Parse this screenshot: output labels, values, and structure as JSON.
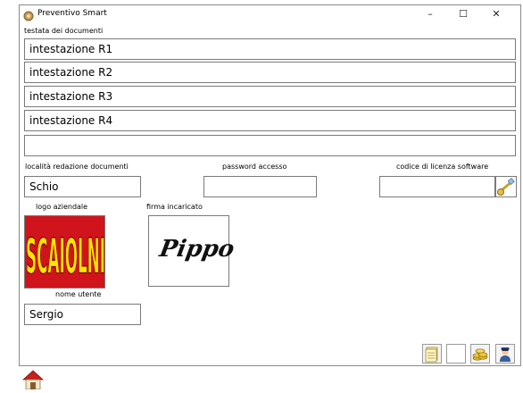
{
  "window": {
    "title": "Preventivo Smart",
    "controls": {
      "minimize": "–",
      "maximize": "☐",
      "close": "✕"
    }
  },
  "header_section": {
    "label": "testata dei documenti",
    "lines": [
      "intestazione R1",
      "intestazione R2",
      "intestazione R3",
      "intestazione R4",
      ""
    ]
  },
  "fields": {
    "location_label": "località redazione documenti",
    "location_value": "Schio",
    "password_label": "password accesso",
    "password_value": "",
    "license_label": "codice di licenza software",
    "license_value": ""
  },
  "images": {
    "logo_label": "logo aziendale",
    "logo_text": "SCAIOLNI",
    "signature_label": "firma incaricato",
    "signature_text": "Pippo"
  },
  "user": {
    "label": "nome utente",
    "value": "Sergio"
  },
  "colors": {
    "logo_background": "#d0141c",
    "logo_text": "#ffe600"
  },
  "icons": {
    "app": "app-icon",
    "license_key": "key-icon",
    "toolbar": [
      "document-stack-icon",
      "blank-icon",
      "coins-icon",
      "officer-icon"
    ],
    "home": "home-icon"
  }
}
